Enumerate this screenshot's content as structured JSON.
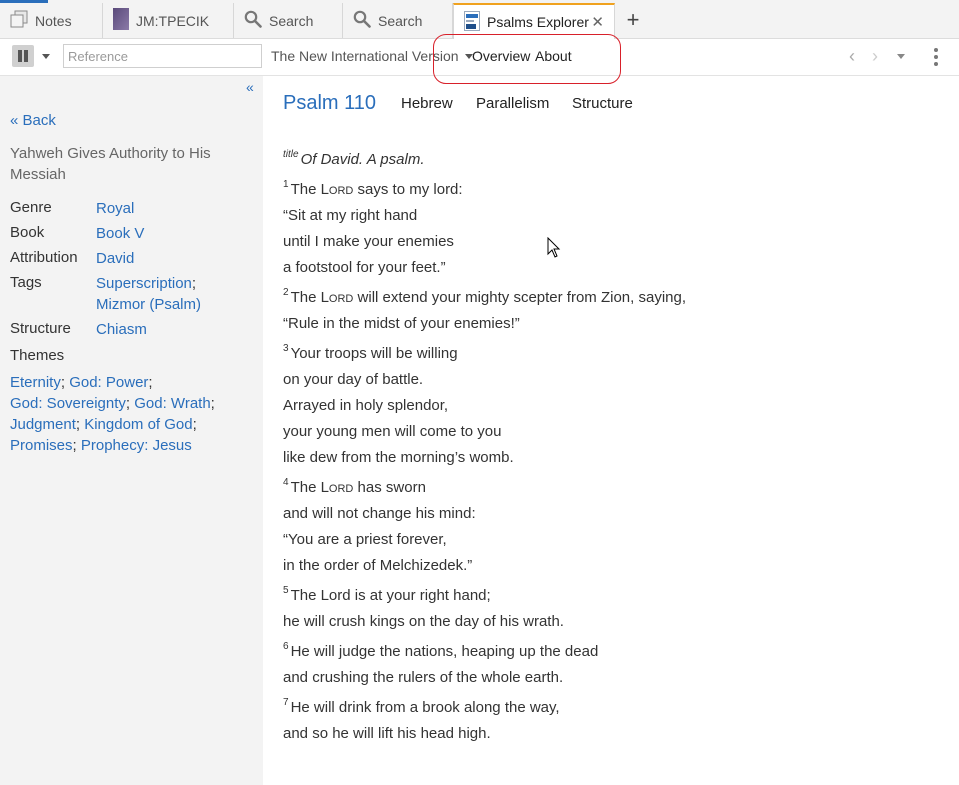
{
  "tabs": [
    {
      "label": "Notes",
      "icon": "notes-icon"
    },
    {
      "label": "JM:TPECIK",
      "icon": "book-cover-icon"
    },
    {
      "label": "Search",
      "icon": "search-icon"
    },
    {
      "label": "Search",
      "icon": "search-icon"
    },
    {
      "label": "Psalms Explorer",
      "icon": "psalms-explorer-icon",
      "active": true
    }
  ],
  "toolbar": {
    "reference_placeholder": "Reference",
    "version_label": "The New International Version",
    "overview_label": "Overview",
    "about_label": "About"
  },
  "sidebar": {
    "collapse_label": "«",
    "back_label": "« Back",
    "title": "Yahweh Gives Authority to His Messiah",
    "genre_label": "Genre",
    "genre_value": "Royal",
    "book_label": "Book",
    "book_value": "Book V",
    "attribution_label": "Attribution",
    "attribution_value": "David",
    "tags_label": "Tags",
    "tags_values": [
      "Superscription",
      "Mizmor (Psalm)"
    ],
    "structure_label": "Structure",
    "structure_value": "Chiasm",
    "themes_label": "Themes",
    "themes": [
      "Eternity",
      "God: Power",
      "God: Sovereignty",
      "God: Wrath",
      "Judgment",
      "Kingdom of God",
      "Promises",
      "Prophecy: Jesus"
    ]
  },
  "main": {
    "psalm_title": "Psalm 110",
    "subtabs": [
      "Hebrew",
      "Parallelism",
      "Structure"
    ],
    "title_marker": "title",
    "title_text": "Of David. A psalm.",
    "lines": [
      {
        "num": "1",
        "pre": "The ",
        "sc": "Lord",
        "post": " says to my lord:"
      },
      {
        "text": "“Sit at my right hand"
      },
      {
        "text": "until I make your enemies"
      },
      {
        "text": "a footstool for your feet.”"
      },
      {
        "num": "2",
        "pre": "The ",
        "sc": "Lord",
        "post": " will extend your mighty scepter from Zion, saying,"
      },
      {
        "text": "“Rule in the midst of your enemies!”"
      },
      {
        "num": "3",
        "text": "Your troops will be willing"
      },
      {
        "text": "on your day of battle."
      },
      {
        "text": "Arrayed in holy splendor,"
      },
      {
        "text": "your young men will come to you"
      },
      {
        "text": "like dew from the morning’s womb."
      },
      {
        "num": "4",
        "pre": "The ",
        "sc": "Lord",
        "post": " has sworn"
      },
      {
        "text": "and will not change his mind:"
      },
      {
        "text": "“You are a priest forever,"
      },
      {
        "text": "in the order of Melchizedek.”"
      },
      {
        "num": "5",
        "text": "The Lord is at your right hand;"
      },
      {
        "text": "he will crush kings on the day of his wrath."
      },
      {
        "num": "6",
        "text": "He will judge the nations, heaping up the dead"
      },
      {
        "text": "and crushing the rulers of the whole earth."
      },
      {
        "num": "7",
        "text": "He will drink from a brook along the way,"
      },
      {
        "text": "and so he will lift his head high."
      }
    ]
  },
  "colors": {
    "link": "#2a6ebb",
    "active_tab_accent": "#f0a21f",
    "highlight_ring": "#d8202a"
  }
}
